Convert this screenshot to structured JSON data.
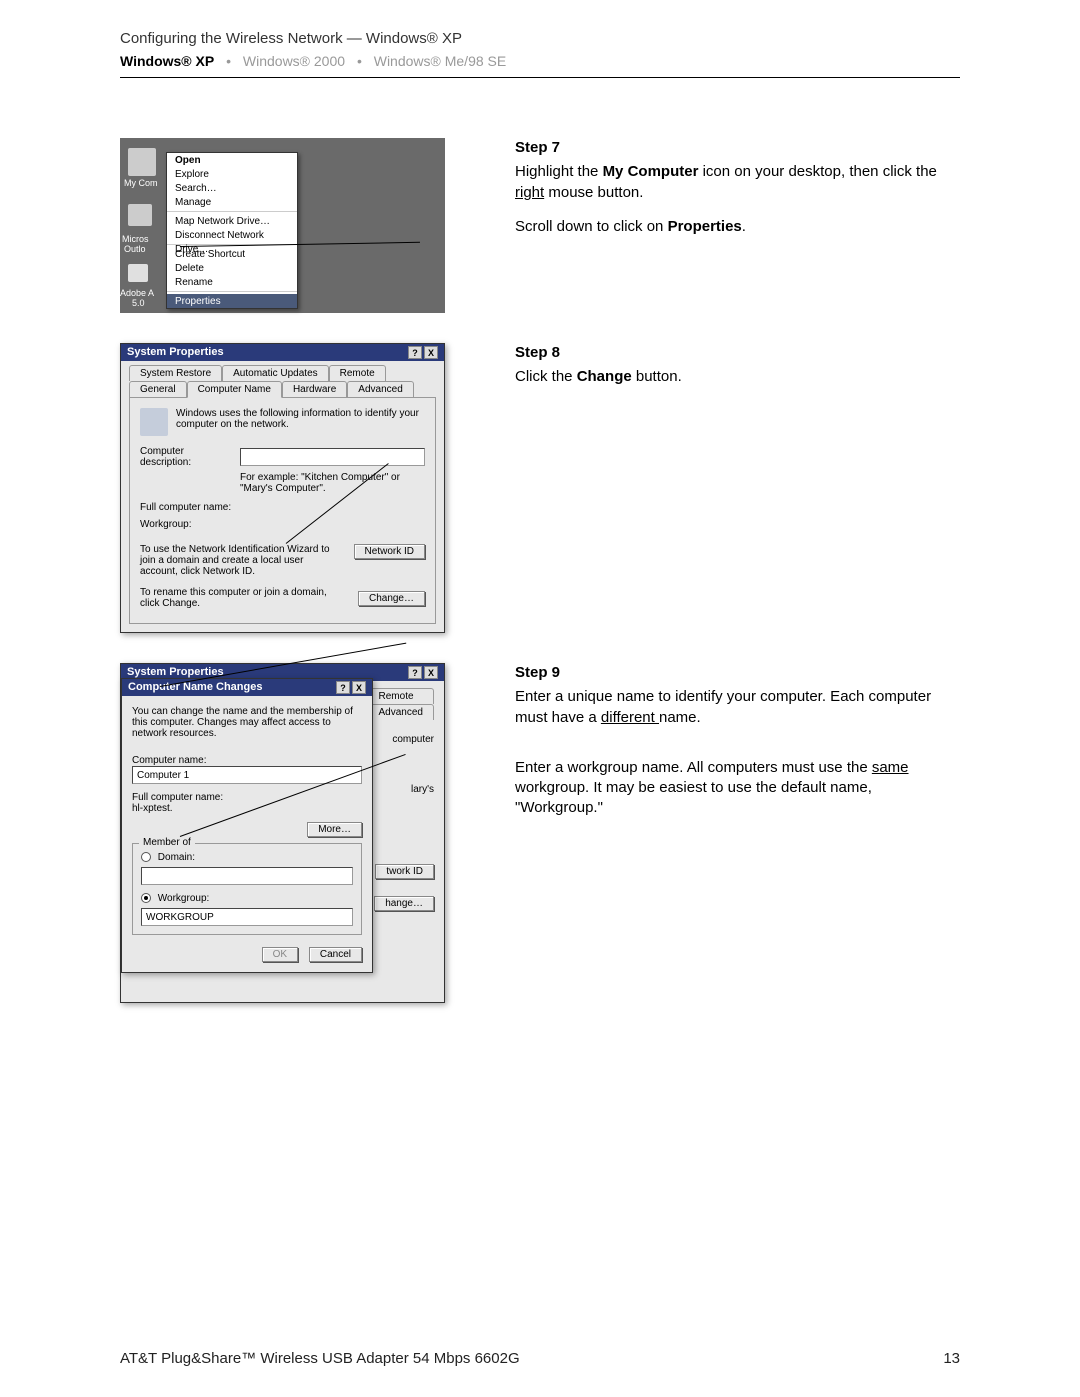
{
  "page_header": {
    "title": "Configuring the Wireless Network — Windows® XP",
    "tabs": {
      "xp": "Windows® XP",
      "w2000": "Windows® 2000",
      "me98": "Windows® Me/98 SE"
    }
  },
  "context_menu": {
    "my_computer": "My Com",
    "micros": "Micros",
    "outlo": "Outlo",
    "adobe": "Adobe A",
    "adobe2": "5.0",
    "items": {
      "open": "Open",
      "explore": "Explore",
      "search": "Search…",
      "manage": "Manage",
      "map": "Map Network Drive…",
      "disconnect": "Disconnect Network Drive…",
      "create": "Create Shortcut",
      "delete": "Delete",
      "rename": "Rename",
      "properties": "Properties"
    }
  },
  "step7": {
    "title": "Step 7",
    "line1a": "Highlight the ",
    "line1b": "My Computer",
    "line1c": " icon on your desktop, then click the ",
    "line1d": "right",
    "line1e": " mouse button.",
    "line2a": "Scroll down to click on ",
    "line2b": "Properties",
    "line2c": "."
  },
  "sysprops": {
    "title": "System Properties",
    "help": "?",
    "close": "X",
    "tabs_top": {
      "sr": "System Restore",
      "au": "Automatic Updates",
      "remote": "Remote"
    },
    "tabs_bot": {
      "general": "General",
      "cname": "Computer Name",
      "hw": "Hardware",
      "adv": "Advanced"
    },
    "explain": "Windows uses the following information to identify your computer on the network.",
    "desc_label": "Computer description:",
    "desc_value": "",
    "desc_example": "For example: \"Kitchen Computer\" or \"Mary's Computer\".",
    "fullname_label": "Full computer name:",
    "workgroup_label": "Workgroup:",
    "nid_text": "To use the Network Identification Wizard to join a domain and create a local user account, click Network ID.",
    "nid_btn": "Network ID",
    "change_text": "To rename this computer or join a domain, click Change.",
    "change_btn": "Change…"
  },
  "step8": {
    "title": "Step 8",
    "line1a": "Click the ",
    "line1b": "Change",
    "line1c": " button."
  },
  "cnc": {
    "title_back": "System Properties",
    "title": "Computer Name Changes",
    "help": "?",
    "close": "X",
    "note": "You can change the name and the membership of this computer. Changes may affect access to network resources.",
    "cname_label": "Computer name:",
    "cname_value": "Computer 1",
    "fullname_label": "Full computer name:",
    "fullname_value": "hl-xptest.",
    "more_btn": "More…",
    "member_legend": "Member of",
    "domain_label": "Domain:",
    "domain_value": "",
    "workgroup_label": "Workgroup:",
    "workgroup_value": "WORKGROUP",
    "ok_btn": "OK",
    "cancel_btn": "Cancel",
    "bg_tabs": {
      "remote": "Remote",
      "adv": "Advanced"
    },
    "bg_text1": "computer",
    "bg_text2": "lary's",
    "bg_btn1": "twork ID",
    "bg_btn2": "hange…"
  },
  "step9": {
    "title": "Step 9",
    "p1a": "Enter a unique name to identify your computer. Each computer must have a ",
    "p1b": "different ",
    "p1c": "name.",
    "p2a": "Enter a workgroup name. All computers must use the ",
    "p2b": "same",
    "p2c": " workgroup. It may be easiest to use the default name, \"Workgroup.\""
  },
  "footer": {
    "product": "AT&T Plug&Share™ Wireless USB Adapter 54 Mbps 6602G",
    "page": "13"
  }
}
